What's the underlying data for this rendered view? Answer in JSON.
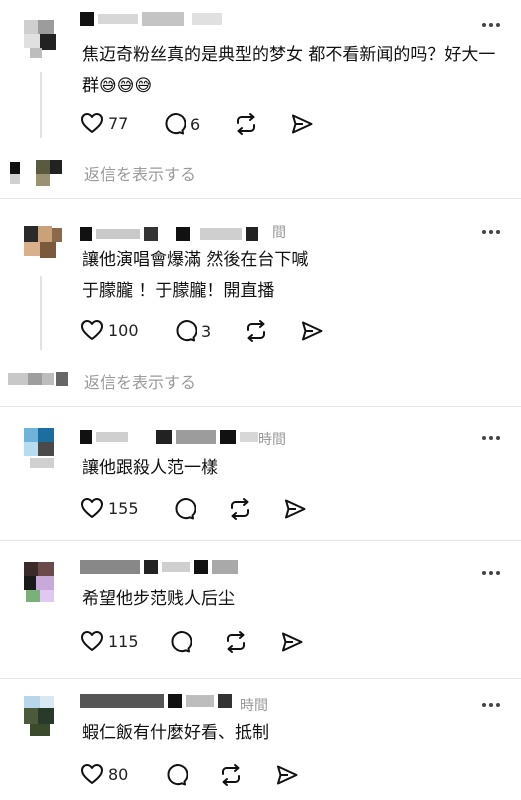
{
  "comments": [
    {
      "text": "焦迈奇粉丝真的是典型的梦女 都不看新闻的吗？好大一群",
      "emoji": "😅😅😅",
      "time": "",
      "likes": "77",
      "replies": "6",
      "show_replies": "返信を表示する"
    },
    {
      "text": "讓他演唱會爆滿 然後在台下喊\n于朦朧 ！于朦朧！開直播",
      "time": "間",
      "likes": "100",
      "replies": "3",
      "show_replies": "返信を表示する"
    },
    {
      "text": "讓他跟殺人范一樣",
      "time": "時間",
      "likes": "155",
      "replies": ""
    },
    {
      "text": "希望他步范贱人后尘",
      "time": "",
      "likes": "115",
      "replies": ""
    },
    {
      "text": "蝦仁飯有什麼好看、抵制",
      "time": "時間",
      "likes": "80",
      "replies": ""
    }
  ],
  "icons": {
    "like": "heart-icon",
    "reply": "speech-bubble-icon",
    "repost": "repost-icon",
    "share": "send-icon",
    "more": "more-icon"
  },
  "colors": {
    "text": "#111111",
    "muted": "#999999",
    "separator": "#e6e6e6"
  }
}
